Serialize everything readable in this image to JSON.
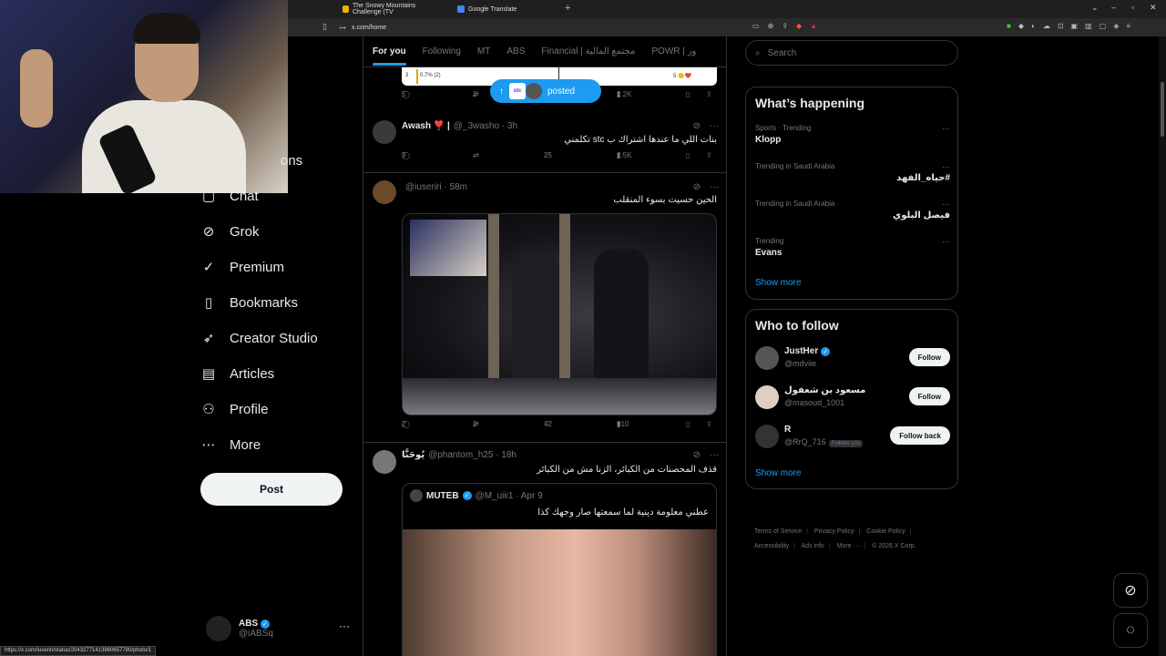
{
  "browser": {
    "tabs": [
      {
        "title": "The Snowy Mountains Challenge (TV",
        "color": "#e8b400"
      },
      {
        "title": "Google Translate",
        "color": "#4285f4"
      }
    ],
    "url": "x.com/home",
    "status_url": "https://x.com/iuserin/status/20432771413960657780/photo/1"
  },
  "nav": {
    "items": [
      {
        "label": "ons",
        "icon": "envelope-icon"
      },
      {
        "label": "Chat",
        "icon": "chat-icon"
      },
      {
        "label": "Grok",
        "icon": "grok-icon"
      },
      {
        "label": "Premium",
        "icon": "premium-icon"
      },
      {
        "label": "Bookmarks",
        "icon": "bookmark-icon"
      },
      {
        "label": "Creator Studio",
        "icon": "rocket-icon"
      },
      {
        "label": "Articles",
        "icon": "article-icon"
      },
      {
        "label": "Profile",
        "icon": "profile-icon"
      },
      {
        "label": "More",
        "icon": "more-circle-icon"
      }
    ],
    "post_label": "Post",
    "account": {
      "name": "ABS",
      "handle": "@iABSq"
    }
  },
  "timeline": {
    "tabs": [
      "For you",
      "Following",
      "MT",
      "ABS",
      "Financial | مجتمع المالية",
      "POWR | ور"
    ],
    "poll": {
      "row_num": "3",
      "row_pct": "0.7% (2)",
      "right": "5 🙂❤️"
    },
    "first_actions": {
      "replies": "5",
      "reposts": "2",
      "views": "2.2K"
    },
    "posted_pill": {
      "stc": "stc",
      "label": "posted"
    },
    "tweets": [
      {
        "name": "Awash ❣️ |",
        "handle": "@_3washo · 3h",
        "text": "بنات اللي ما عندها اشتراك ب stc تكلمني",
        "replies": "9",
        "reposts": "",
        "likes": "25",
        "views": "2.5K"
      },
      {
        "name": "",
        "handle": "@iuseriri · 58m",
        "text": "الحين حسيت بسوء المنقلب",
        "replies": "2",
        "reposts": "2",
        "likes": "42",
        "views": "910"
      },
      {
        "name": "يُوحَنَّا",
        "handle": "@phantom_h25 · 18h",
        "text": "قذف المحصنات من الكبائر، الزنا مش من الكبائر",
        "quote": {
          "name": "MUTEB",
          "handle": "@M_uiii1 · Apr 9",
          "text": "عطني معلومة دينية لما سمعتها صار وجهك كذا"
        }
      }
    ]
  },
  "search": {
    "placeholder": "Search"
  },
  "trending": {
    "title": "What’s happening",
    "items": [
      {
        "category": "Sports · Trending",
        "topic": "Klopp",
        "rtl": false
      },
      {
        "category": "Trending in Saudi Arabia",
        "topic": "#حياه_الفهد",
        "rtl": true
      },
      {
        "category": "Trending in Saudi Arabia",
        "topic": "فيصل البلوي",
        "rtl": true
      },
      {
        "category": "Trending",
        "topic": "Evans",
        "rtl": false
      }
    ],
    "show_more": "Show more"
  },
  "who_to_follow": {
    "title": "Who to follow",
    "items": [
      {
        "name": "JustHer",
        "handle": "@mdviie",
        "button": "Follow",
        "verified": true,
        "follows_you": ""
      },
      {
        "name": "مسعود بن شعفول",
        "handle": "@masoud_1001",
        "button": "Follow",
        "verified": false,
        "follows_you": ""
      },
      {
        "name": "R",
        "handle": "@RrQ_716",
        "button": "Follow back",
        "verified": false,
        "follows_you": "Follows you"
      }
    ],
    "show_more": "Show more"
  },
  "footer": {
    "links": [
      "Terms of Service",
      "Privacy Policy",
      "Cookie Policy",
      "Accessibility",
      "Ads info",
      "More ···",
      "© 2026 X Corp."
    ]
  },
  "colors": {
    "accent": "#1d9bf0",
    "bg": "#000000",
    "border": "#2f3336",
    "muted": "#71767b"
  }
}
